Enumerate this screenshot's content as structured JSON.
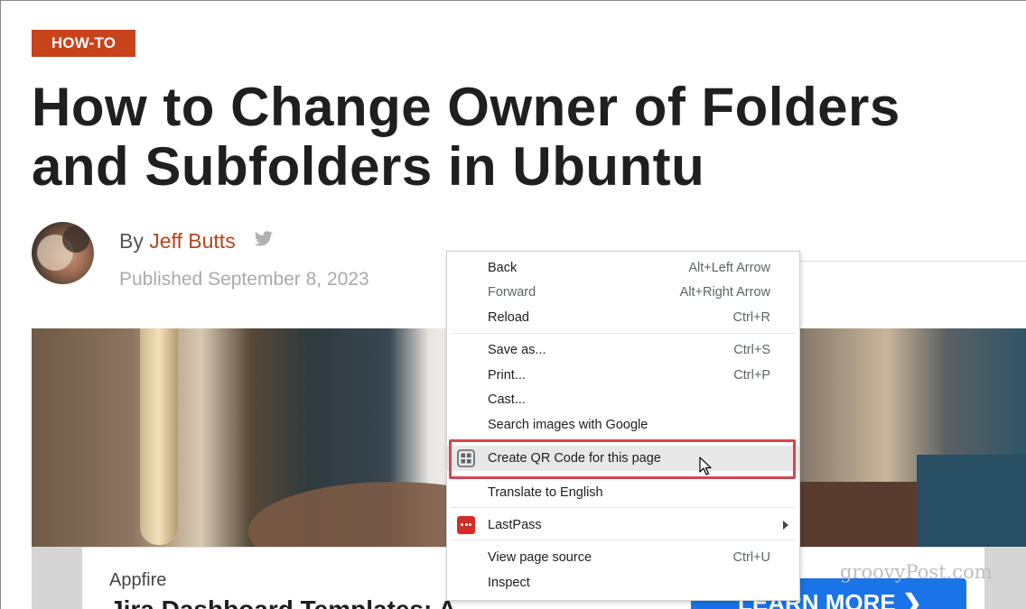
{
  "article": {
    "category": "HOW-TO",
    "title_line1": "How to Change Owner of Folders",
    "title_line2": "and Subfolders in Ubuntu",
    "by_prefix": "By",
    "author": "Jeff Butts",
    "published": "Published September 8, 2023"
  },
  "ad": {
    "brand": "Appfire",
    "headline": "Jira Dashboard Templates: A",
    "button_label": "LEARN MORE ❯"
  },
  "watermark": "groovyPost.com",
  "context_menu": {
    "items": [
      {
        "label": "Back",
        "shortcut": "Alt+Left Arrow"
      },
      {
        "label": "Forward",
        "shortcut": "Alt+Right Arrow"
      },
      {
        "label": "Reload",
        "shortcut": "Ctrl+R"
      },
      {
        "label": "Save as...",
        "shortcut": "Ctrl+S"
      },
      {
        "label": "Print...",
        "shortcut": "Ctrl+P"
      },
      {
        "label": "Cast...",
        "shortcut": ""
      },
      {
        "label": "Search images with Google",
        "shortcut": ""
      },
      {
        "label": "Create QR Code for this page",
        "shortcut": "",
        "icon": "qr-code-icon",
        "highlighted": true
      },
      {
        "label": "Translate to English",
        "shortcut": ""
      },
      {
        "label": "LastPass",
        "shortcut": "",
        "icon": "lastpass-icon",
        "submenu": true
      },
      {
        "label": "View page source",
        "shortcut": "Ctrl+U"
      },
      {
        "label": "Inspect",
        "shortcut": ""
      }
    ]
  },
  "colors": {
    "accent": "#c8421b",
    "author_link": "#b5451b",
    "highlight_border": "#d64550",
    "ad_button": "#1a73e8"
  }
}
